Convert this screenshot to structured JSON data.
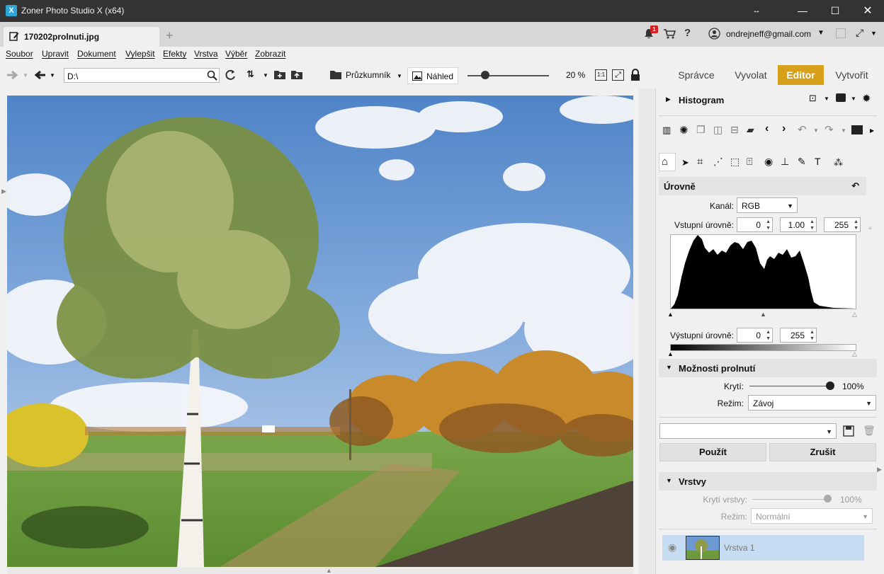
{
  "window": {
    "title": "Zoner Photo Studio X (x64)",
    "app_icon": "X"
  },
  "tab": {
    "label": "170202prolnuti.jpg"
  },
  "account": {
    "email": "ondrejneff@gmail.com",
    "notifications": "1"
  },
  "menu": [
    "Soubor",
    "Upravit",
    "Dokument",
    "Vylepšit",
    "Efekty",
    "Vrstva",
    "Výběr",
    "Zobrazit"
  ],
  "toolbar": {
    "path": "D:\\",
    "explorer_label": "Průzkumník",
    "preview_label": "Náhled",
    "zoom": "20 %",
    "one_to_one": "1:1",
    "zoom_fraction": 0.22
  },
  "modes": [
    "Správce",
    "Vyvolat",
    "Editor",
    "Vytvořit"
  ],
  "active_mode": "Editor",
  "panel": {
    "histogram_title": "Histogram",
    "levels": {
      "title": "Úrovně",
      "channel_label": "Kanál:",
      "channel_value": "RGB",
      "input_label": "Vstupní úrovně:",
      "input_black": "0",
      "input_gamma": "1.00",
      "input_white": "255",
      "output_label": "Výstupní úrovně:",
      "output_black": "0",
      "output_white": "255"
    },
    "blend": {
      "title": "Možnosti prolnutí",
      "opacity_label": "Krytí:",
      "opacity_value": "100%",
      "mode_label": "Režim:",
      "mode_value": "Závoj"
    },
    "apply_label": "Použít",
    "cancel_label": "Zrušit",
    "layers": {
      "title": "Vrstvy",
      "opacity_label": "Krytí vrstvy:",
      "opacity_value": "100%",
      "mode_label": "Režim:",
      "mode_value": "Normální",
      "items": [
        "Vrstva 1"
      ]
    }
  },
  "colors": {
    "active_mode_bg": "#d7a01a",
    "titlebar": "#333333",
    "layer_selected": "#c6dcf3",
    "badge": "#d21f1f"
  }
}
